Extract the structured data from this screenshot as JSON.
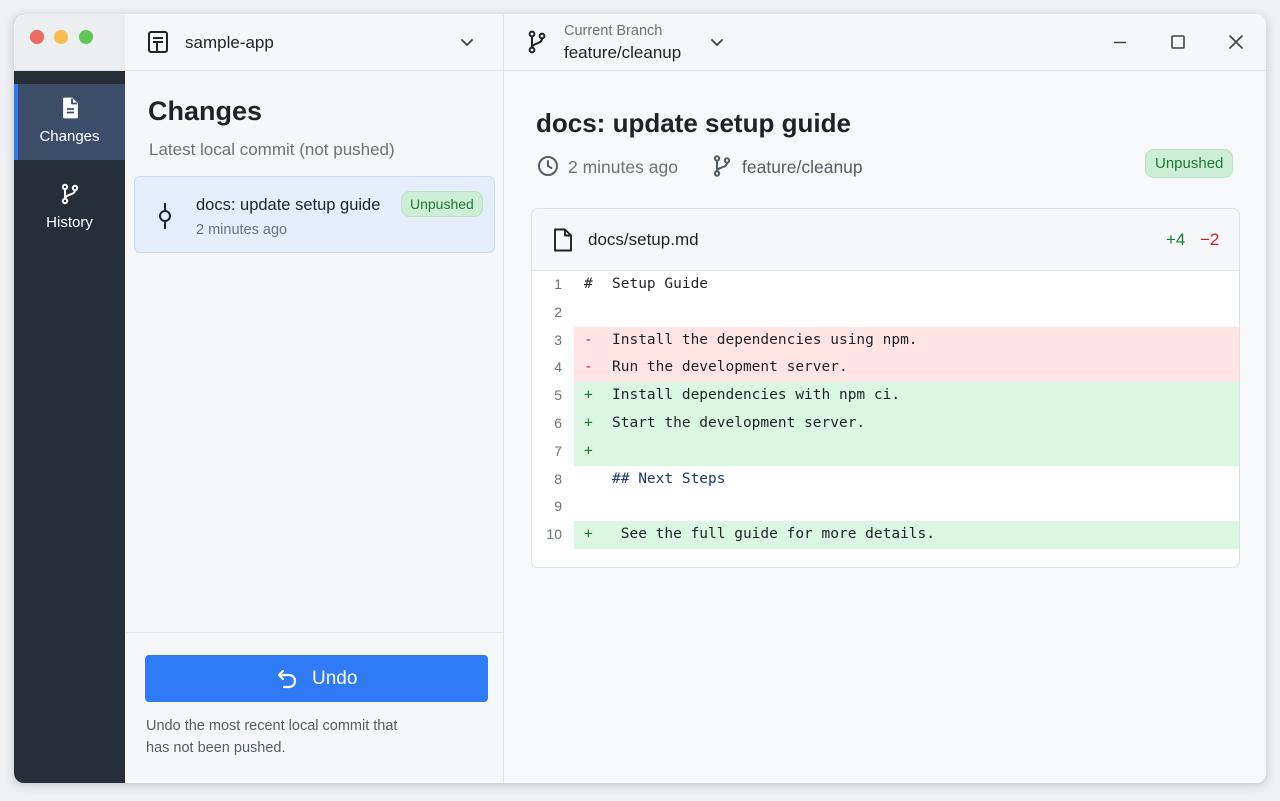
{
  "sidebar": {
    "items": [
      {
        "label": "Changes",
        "icon": "file-icon",
        "active": true
      },
      {
        "label": "History",
        "icon": "branch-icon",
        "active": false
      }
    ]
  },
  "repo": {
    "name": "sample-app"
  },
  "changes": {
    "title": "Changes",
    "subtitle": "Latest local commit (not pushed)",
    "commit": {
      "title": "docs: update setup guide",
      "time": "2 minutes ago",
      "badge": "Unpushed"
    }
  },
  "undo": {
    "label": "Undo",
    "description": "Undo the most recent local commit that has not been pushed."
  },
  "branch": {
    "label": "Current Branch",
    "name": "feature/cleanup"
  },
  "detail": {
    "title": "docs: update setup guide",
    "time": "2 minutes ago",
    "branch": "feature/cleanup",
    "badge": "Unpushed"
  },
  "diff": {
    "file": "docs/setup.md",
    "additions": "+4",
    "deletions": "−2",
    "lines": [
      {
        "num": "1",
        "type": "ctx",
        "marker": "#",
        "text": "Setup Guide"
      },
      {
        "num": "2",
        "type": "ctx",
        "marker": "",
        "text": ""
      },
      {
        "num": "3",
        "type": "del",
        "marker": "-",
        "text": "Install the dependencies using npm."
      },
      {
        "num": "4",
        "type": "del",
        "marker": "-",
        "text": "Run the development server."
      },
      {
        "num": "5",
        "type": "add",
        "marker": "+",
        "text": "Install dependencies with npm ci."
      },
      {
        "num": "6",
        "type": "add",
        "marker": "+",
        "text": "Start the development server."
      },
      {
        "num": "7",
        "type": "add",
        "marker": "+",
        "text": ""
      },
      {
        "num": "8",
        "type": "heading",
        "marker": "",
        "text": "## Next Steps"
      },
      {
        "num": "9",
        "type": "ctx",
        "marker": "",
        "text": ""
      },
      {
        "num": "10",
        "type": "add",
        "marker": "+",
        "text": " See the full guide for more details."
      }
    ]
  },
  "colors": {
    "accent": "#2f7bf5",
    "sidebar": "#262e38",
    "added": "#dcf7e1",
    "removed": "#ffe4e6",
    "badge": "#cdeed4"
  }
}
